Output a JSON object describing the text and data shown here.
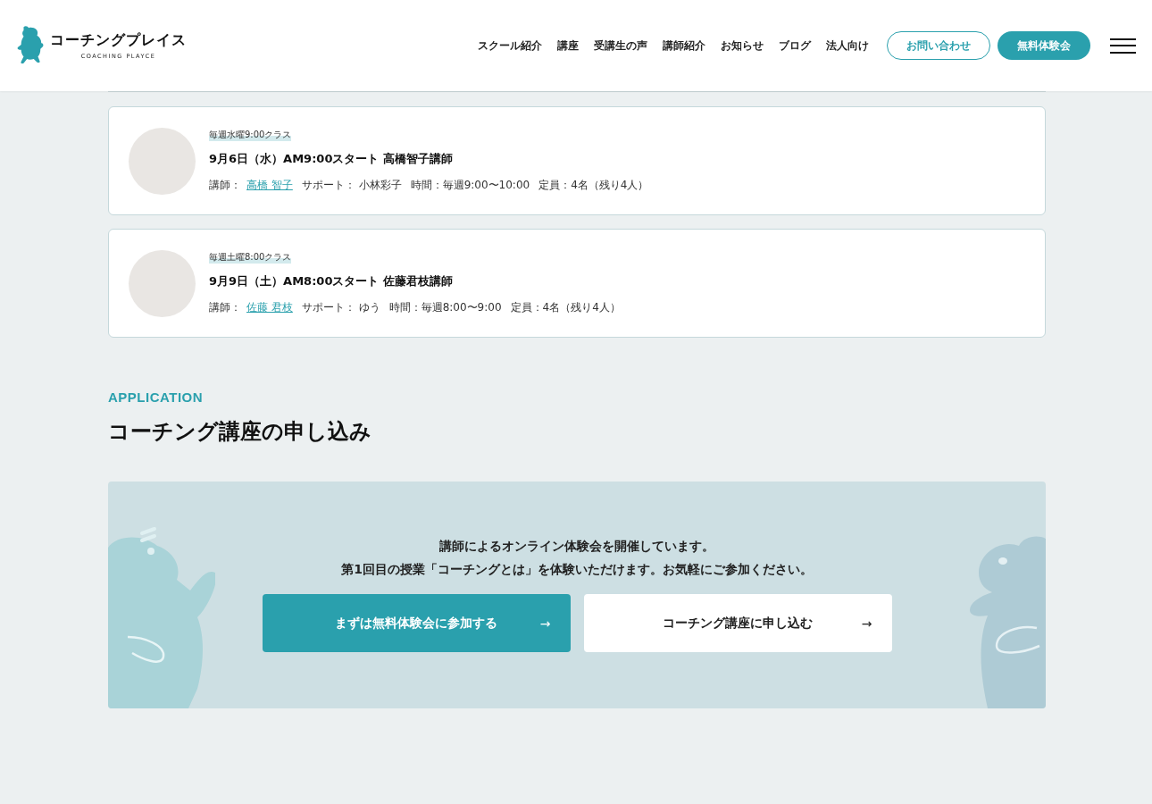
{
  "header": {
    "logo": {
      "name": "コーチングプレイス",
      "sub": "COACHING PLAYCE"
    },
    "nav": [
      {
        "label": "スクール紹介"
      },
      {
        "label": "講座"
      },
      {
        "label": "受講生の声"
      },
      {
        "label": "講師紹介"
      },
      {
        "label": "お知らせ"
      },
      {
        "label": "ブログ"
      },
      {
        "label": "法人向け"
      }
    ],
    "buttons": [
      {
        "label": "お問い合わせ",
        "kind": "outline"
      },
      {
        "label": "無料体験会",
        "kind": "filled"
      }
    ]
  },
  "classes": [
    {
      "tag": "毎週水曜9:00クラス",
      "title": "9月6日（水）AM9:00スタート 高橋智子講師",
      "teacher_label": "講師：",
      "teacher": "高橋 智子",
      "support": "サポート： 小林彩子",
      "time": "時間：毎週9:00〜10:00",
      "capacity": "定員：4名（残り4人）"
    },
    {
      "tag": "毎週土曜8:00クラス",
      "title": "9月9日（土）AM8:00スタート 佐藤君枝講師",
      "teacher_label": "講師：",
      "teacher": "佐藤 君枝",
      "support": "サポート： ゆう",
      "time": "時間：毎週8:00〜9:00",
      "capacity": "定員：4名（残り4人）"
    }
  ],
  "application": {
    "eyebrow": "APPLICATION",
    "title": "コーチング講座の申し込み",
    "lines": [
      "講師によるオンライン体験会を開催しています。",
      "第1回目の授業「コーチングとは」を体験いただけます。お気軽にご参加ください。"
    ],
    "buttons": [
      {
        "label": "まずは無料体験会に参加する",
        "arrow": "→",
        "kind": "primary"
      },
      {
        "label": "コーチング講座に申し込む",
        "arrow": "→",
        "kind": "secondary"
      }
    ]
  }
}
